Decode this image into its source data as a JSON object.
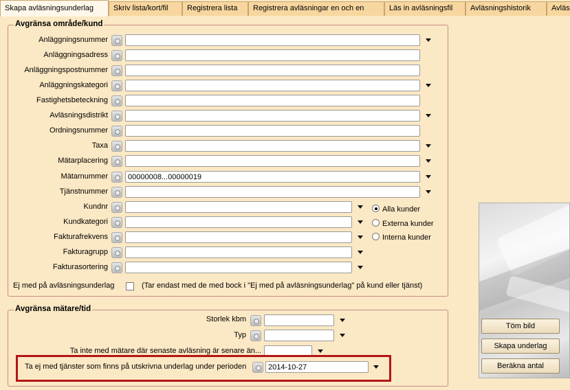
{
  "tabs": [
    {
      "label": "Skapa avläsningsunderlag"
    },
    {
      "label": "Skriv lista/kort/fil"
    },
    {
      "label": "Registrera lista"
    },
    {
      "label": "Registrera avläsningar en och en"
    },
    {
      "label": "Läs in avläsningsfil"
    },
    {
      "label": "Avläsningshistorik"
    },
    {
      "label": "Avläs"
    }
  ],
  "group1": {
    "title": "Avgränsa område/kund",
    "fields": [
      {
        "label": "Anläggningsnummer",
        "value": ""
      },
      {
        "label": "Anläggningsadress",
        "value": ""
      },
      {
        "label": "Anläggningspostnummer",
        "value": ""
      },
      {
        "label": "Anläggningskategori",
        "value": ""
      },
      {
        "label": "Fastighetsbeteckning",
        "value": ""
      },
      {
        "label": "Avläsningsdistrikt",
        "value": ""
      },
      {
        "label": "Ordningsnummer",
        "value": ""
      },
      {
        "label": "Taxa",
        "value": ""
      },
      {
        "label": "Mätarplacering",
        "value": ""
      },
      {
        "label": "Mätarnummer",
        "value": "00000008...00000019"
      },
      {
        "label": "Tjänstnummer",
        "value": ""
      },
      {
        "label": "Kundnr",
        "value": ""
      },
      {
        "label": "Kundkategori",
        "value": ""
      },
      {
        "label": "Fakturafrekvens",
        "value": ""
      },
      {
        "label": "Fakturagrupp",
        "value": ""
      },
      {
        "label": "Fakturasortering",
        "value": ""
      }
    ],
    "radios": [
      {
        "label": "Alla kunder",
        "selected": true
      },
      {
        "label": "Externa kunder",
        "selected": false
      },
      {
        "label": "Interna kunder",
        "selected": false
      }
    ],
    "exclude_label": "Ej med på avläsningsunderlag",
    "exclude_note": "(Tar endast med de med bock i \"Ej med på avläsningsunderlag\" på kund eller tjänst)"
  },
  "group2": {
    "title": "Avgränsa mätare/tid",
    "storlek_label": "Storlek kbm",
    "storlek_value": "",
    "typ_label": "Typ",
    "typ_value": "",
    "senaste_label": "Ta inte med mätare där senaste avläsning är senare än...",
    "senaste_value": "",
    "tjanster_label": "Ta ej med tjänster som finns på utskrivna underlag under perioden",
    "tjanster_value": "2014-10-27"
  },
  "buttons": {
    "tom_bild": "Töm bild",
    "skapa_underlag": "Skapa underlag",
    "berakna_antal": "Beräkna antal"
  },
  "colors": {
    "background": "#fbe8c4",
    "highlight": "#b21515"
  }
}
